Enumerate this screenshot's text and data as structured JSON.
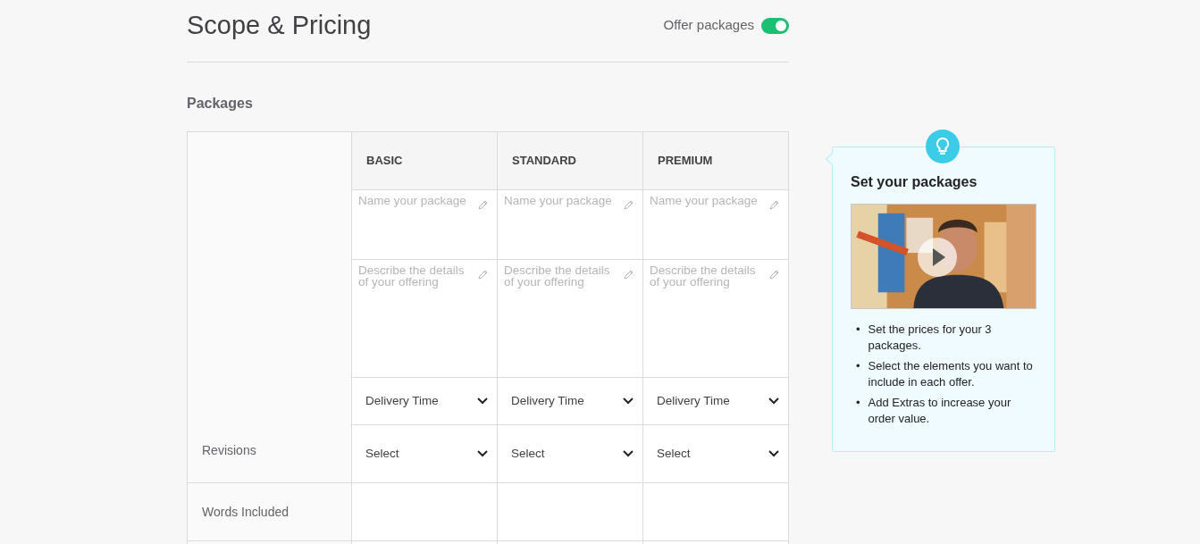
{
  "header": {
    "title": "Scope & Pricing",
    "toggle": {
      "label": "Offer packages",
      "on": true
    }
  },
  "section_title": "Packages",
  "packages": [
    {
      "name": "BASIC",
      "name_placeholder": "Name your package",
      "description_placeholder": "Describe the details of your offering",
      "delivery": "Delivery Time",
      "revisions": "Select"
    },
    {
      "name": "STANDARD",
      "name_placeholder": "Name your package",
      "description_placeholder": "Describe the details of your offering",
      "delivery": "Delivery Time",
      "revisions": "Select"
    },
    {
      "name": "PREMIUM",
      "name_placeholder": "Name your package",
      "description_placeholder": "Describe the details of your offering",
      "delivery": "Delivery Time",
      "revisions": "Select"
    }
  ],
  "row_labels": {
    "revisions": "Revisions",
    "words_included": "Words Included"
  },
  "tip": {
    "title": "Set your packages",
    "bullets": [
      {
        "marker": "•",
        "text": "Set the prices for your 3 packages."
      },
      {
        "marker": "•",
        "text": "Select the elements you want to include in each offer."
      },
      {
        "marker": "•",
        "text": "Add Extras to increase your order value."
      }
    ]
  }
}
